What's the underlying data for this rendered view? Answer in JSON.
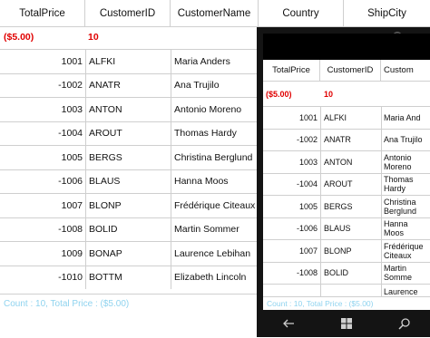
{
  "columns": [
    "TotalPrice",
    "CustomerID",
    "CustomerName",
    "Country",
    "ShipCity"
  ],
  "summary": {
    "total": "($5.00)",
    "count": "10"
  },
  "rows": [
    {
      "price": "1001",
      "id": "ALFKI",
      "name": "Maria Anders"
    },
    {
      "price": "-1002",
      "id": "ANATR",
      "name": "Ana Trujilo"
    },
    {
      "price": "1003",
      "id": "ANTON",
      "name": "Antonio Moreno"
    },
    {
      "price": "-1004",
      "id": "AROUT",
      "name": "Thomas Hardy"
    },
    {
      "price": "1005",
      "id": "BERGS",
      "name": "Christina Berglund"
    },
    {
      "price": "-1006",
      "id": "BLAUS",
      "name": "Hanna Moos"
    },
    {
      "price": "1007",
      "id": "BLONP",
      "name": "Frédérique Citeaux"
    },
    {
      "price": "-1008",
      "id": "BOLID",
      "name": "Martin Sommer"
    },
    {
      "price": "1009",
      "id": "BONAP",
      "name": "Laurence Lebihan"
    },
    {
      "price": "-1010",
      "id": "BOTTM",
      "name": "Elizabeth Lincoln"
    }
  ],
  "footer": "Count : 10, Total Price : ($5.00)",
  "phone": {
    "columns": [
      "TotalPrice",
      "CustomerID",
      "Custom"
    ],
    "rows": [
      {
        "price": "1001",
        "id": "ALFKI",
        "name": "Maria And"
      },
      {
        "price": "-1002",
        "id": "ANATR",
        "name": "Ana Trujilo"
      },
      {
        "price": "1003",
        "id": "ANTON",
        "name": "Antonio Moreno"
      },
      {
        "price": "-1004",
        "id": "AROUT",
        "name": "Thomas Hardy"
      },
      {
        "price": "1005",
        "id": "BERGS",
        "name": "Christina Berglund"
      },
      {
        "price": "-1006",
        "id": "BLAUS",
        "name": "Hanna Moos"
      },
      {
        "price": "1007",
        "id": "BLONP",
        "name": "Frédérique Citeaux"
      },
      {
        "price": "-1008",
        "id": "BOLID",
        "name": "Martin Somme"
      },
      {
        "price": "",
        "id": "",
        "name": "Laurence"
      }
    ],
    "footer": "Count : 10, Total Price : ($5.00)",
    "nav_icons": [
      "back-arrow-icon",
      "windows-start-icon",
      "search-icon"
    ]
  },
  "colors": {
    "negative": "#e00000",
    "footer_text": "#8fd3ef",
    "phone_frame": "#141414"
  }
}
